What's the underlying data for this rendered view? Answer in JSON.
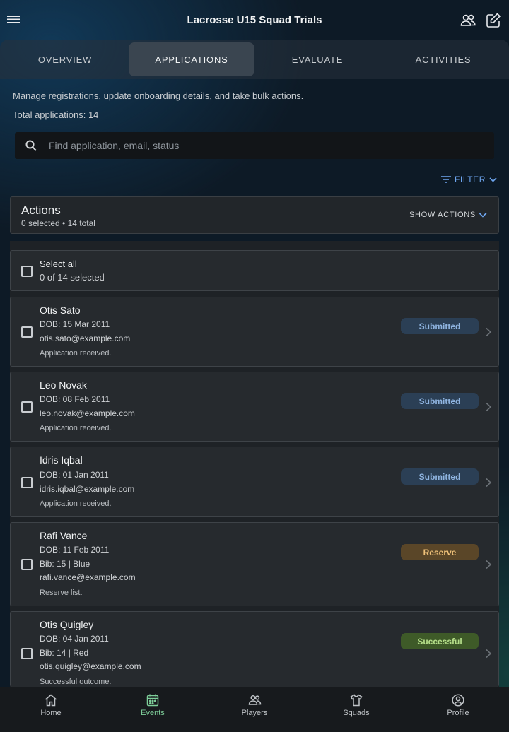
{
  "app": {
    "title": "Lacrosse U15 Squad Trials"
  },
  "header": {
    "menu_icon": "menu-icon",
    "team_icon": "users-icon",
    "edit_icon": "edit-icon"
  },
  "tabs": [
    {
      "label": "OVERVIEW",
      "active": false
    },
    {
      "label": "APPLICATIONS",
      "active": true
    },
    {
      "label": "EVALUATE",
      "active": false
    },
    {
      "label": "ACTIVITIES",
      "active": false
    }
  ],
  "intro": "Manage registrations, update onboarding details, and take bulk actions.",
  "total_text": "Total applications: 14",
  "search": {
    "placeholder": "Find application, email, status",
    "value": ""
  },
  "filter": {
    "label": "FILTER"
  },
  "actions": {
    "title": "Actions",
    "summary": "0 selected • 14 total",
    "toggle_label": "SHOW ACTIONS"
  },
  "select_all": {
    "label": "Select all",
    "count": "0 of 14 selected"
  },
  "applications": [
    {
      "name": "Otis Sato",
      "dob": "DOB: 15 Mar 2011",
      "bib": "",
      "email": "otis.sato@example.com",
      "note": "Application received.",
      "status": "Submitted"
    },
    {
      "name": "Leo Novak",
      "dob": "DOB: 08 Feb 2011",
      "bib": "",
      "email": "leo.novak@example.com",
      "note": "Application received.",
      "status": "Submitted"
    },
    {
      "name": "Idris Iqbal",
      "dob": "DOB: 01 Jan 2011",
      "bib": "",
      "email": "idris.iqbal@example.com",
      "note": "Application received.",
      "status": "Submitted"
    },
    {
      "name": "Rafi Vance",
      "dob": "DOB: 11 Feb 2011",
      "bib": "Bib: 15 | Blue",
      "email": "rafi.vance@example.com",
      "note": "Reserve list.",
      "status": "Reserve"
    },
    {
      "name": "Otis Quigley",
      "dob": "DOB: 04 Jan 2011",
      "bib": "Bib: 14 | Red",
      "email": "otis.quigley@example.com",
      "note": "Successful outcome.",
      "status": "Successful"
    }
  ],
  "status_colors": {
    "Submitted": "#8fb4e0",
    "Reserve": "#f0c27a",
    "Successful": "#b6e08a"
  },
  "bottom_nav": [
    {
      "label": "Home",
      "icon": "home-icon",
      "active": false
    },
    {
      "label": "Events",
      "icon": "calendar-icon",
      "active": true
    },
    {
      "label": "Players",
      "icon": "players-icon",
      "active": false
    },
    {
      "label": "Squads",
      "icon": "shirt-icon",
      "active": false
    },
    {
      "label": "Profile",
      "icon": "profile-icon",
      "active": false
    }
  ]
}
